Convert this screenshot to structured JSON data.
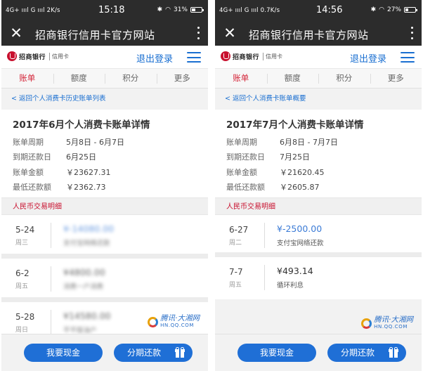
{
  "left": {
    "status": {
      "signal": "4G+ ıııl G ıııl",
      "speed": "2K/s",
      "time": "15:18",
      "battery": "31%",
      "battery_level": 0.31
    },
    "titlebar": {
      "title": "招商银行信用卡官方网站"
    },
    "brand": {
      "name": "招商银行",
      "card": "信用卡",
      "logout": "退出登录"
    },
    "tabs": [
      {
        "label": "账单"
      },
      {
        "label": "额度"
      },
      {
        "label": "积分"
      },
      {
        "label": "更多"
      }
    ],
    "active_tab": 0,
    "back": "< 返回个人消费卡历史账单列表",
    "detail": {
      "title": "2017年6月个人消费卡账单详情",
      "rows": [
        {
          "k": "账单周期",
          "v": "5月8日 - 6月7日"
        },
        {
          "k": "到期还款日",
          "v": "6月25日"
        },
        {
          "k": "账单金额",
          "v": "￥23627.31"
        },
        {
          "k": "最低还款额",
          "v": "￥2362.73"
        }
      ]
    },
    "section": "人民币交易明细",
    "transactions": [
      {
        "date": "5-24",
        "weekday": "周三",
        "amount": "¥-14080.00",
        "desc": "支付宝网络还款",
        "blurred": true,
        "neg": true
      },
      {
        "date": "6-2",
        "weekday": "周五",
        "amount": "¥4800.00",
        "desc": "消费一户消费",
        "blurred": true,
        "neg": false
      },
      {
        "date": "5-28",
        "weekday": "周日",
        "amount": "¥14580.00",
        "desc": "平平版油户",
        "blurred": true,
        "neg": false
      }
    ],
    "bottom": {
      "cash": "我要现金",
      "installment": "分期还款"
    }
  },
  "right": {
    "status": {
      "signal": "4G+ ıııl G ıııl",
      "speed": "0.7K/s",
      "time": "14:56",
      "battery": "27%",
      "battery_level": 0.27
    },
    "titlebar": {
      "title": "招商银行信用卡官方网站"
    },
    "brand": {
      "name": "招商银行",
      "card": "信用卡",
      "logout": "退出登录"
    },
    "tabs": [
      {
        "label": "账单"
      },
      {
        "label": "额度"
      },
      {
        "label": "积分"
      },
      {
        "label": "更多"
      }
    ],
    "active_tab": 0,
    "back": "< 返回个人消费卡账单概要",
    "detail": {
      "title": "2017年7月个人消费卡账单详情",
      "rows": [
        {
          "k": "账单周期",
          "v": "6月8日 - 7月7日"
        },
        {
          "k": "到期还款日",
          "v": "7月25日"
        },
        {
          "k": "账单金额",
          "v": "￥21620.45"
        },
        {
          "k": "最低还款额",
          "v": "￥2605.87"
        }
      ]
    },
    "section": "人民币交易明细",
    "transactions": [
      {
        "date": "6-27",
        "weekday": "周二",
        "amount": "¥-2500.00",
        "desc": "支付宝网络还款",
        "blurred": false,
        "neg": true
      },
      {
        "date": "7-7",
        "weekday": "周五",
        "amount": "¥493.14",
        "desc": "循环利息",
        "blurred": false,
        "neg": false
      }
    ],
    "bottom": {
      "cash": "我要现金",
      "installment": "分期还款"
    }
  },
  "watermark": {
    "cn": "腾讯·大湘网",
    "en": "HN.QQ.COM"
  },
  "icons": {
    "close": "close-icon",
    "more": "more-vertical-icon",
    "menu": "hamburger-menu-icon",
    "gift": "gift-icon",
    "bluetooth": "bluetooth-icon",
    "wifi": "wifi-icon"
  },
  "colors": {
    "header": "#2c2c2c",
    "brand_blue": "#1a6fd1",
    "button_blue": "#1f6fd6",
    "accent_red": "#d4263a"
  }
}
